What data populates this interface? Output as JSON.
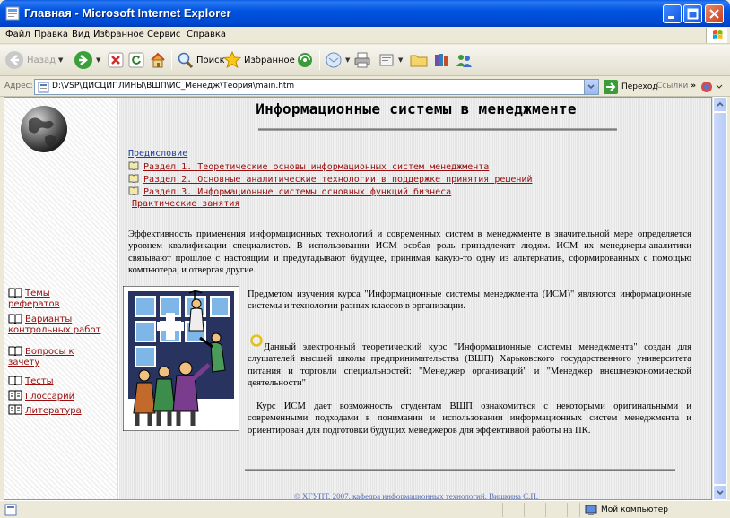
{
  "window": {
    "title": "Главная - Microsoft Internet Explorer"
  },
  "menu": [
    "Файл",
    "Правка",
    "Вид",
    "Избранное",
    "Сервис",
    "Справка"
  ],
  "toolbar": {
    "back": "Назад",
    "search": "Поиск",
    "favorites": "Избранное"
  },
  "address": {
    "label": "Адрес:",
    "url": "D:\\VSP\\ДИСЦИПЛИНЫ\\ВШП\\ИС_Менедж\\Теория\\main.htm",
    "go": "Переход",
    "links": "Ссылки"
  },
  "nav": {
    "items": [
      {
        "line1": "Темы",
        "line2": "рефератов"
      },
      {
        "line1": "Варианты",
        "line2": "контрольных работ"
      },
      {
        "line1": "Вопросы к",
        "line2": "зачету"
      },
      {
        "line1": "Тесты",
        "line2": ""
      },
      {
        "line1": "Глоссарий",
        "line2": ""
      },
      {
        "line1": "Литература",
        "line2": ""
      }
    ]
  },
  "page": {
    "title": "Информационные системы в менеджменте",
    "toc": {
      "preface": "Предисловие",
      "section1": "Раздел 1. Теоретические основы информационных систем менеджмента",
      "section2": "Раздел 2. Основные аналитические технологии в поддержке принятия решений",
      "section3": "Раздел 3. Информационные системы основных функций бизнеса",
      "practice": "Практические занятия"
    },
    "para1": "Эффективность применения информационных технологий и современных систем в менеджменте в значительной мере определяется уровнем квалификации специалистов. В использовании ИСМ особая роль принадлежит людям. ИСМ их менеджеры-аналитики связывают прошлое с настоящим и предугадывают будущее, принимая какую-то одну из альтернатив, сформированных с помощью компьютера, и отвергая другие.",
    "para2": "Предметом изучения курса \"Информационные системы менеджмента (ИСМ)\" являются информационные системы и технологии разных классов в организации.",
    "para3": "Данный электронный теоретический курс \"Информационные системы менеджмента\" создан для слушателей высшей школы предпринимательства (ВШП) Харьковского государственного университета питания и торговли специальностей: \"Менеджер организаций\" и \"Менеджер внешнеэкономической деятельности\"",
    "para4": "Курс ИСМ дает возможность студентам ВШП ознакомиться с некоторыми оригинальными и современными подходами в понимании и использовании информационных систем менеджмента и ориентирован для подготовки будущих менеджеров для эффективной работы на ПК.",
    "footer": "© ХГУПТ, 2007, кафедра информационных технологий, Вишкина С.П."
  },
  "status": {
    "zone": "Мой компьютер"
  },
  "colors": {
    "link_blue": "#1a3f9e",
    "link_red": "#9a0e0e",
    "titlebar": "#0053e0"
  }
}
